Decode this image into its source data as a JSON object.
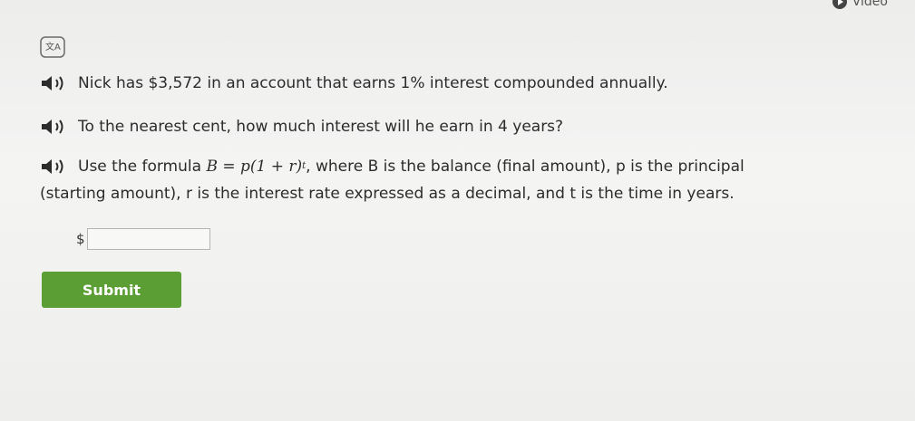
{
  "header": {
    "video_label": "Video"
  },
  "icons": {
    "translate": "translate-icon",
    "speaker": "speaker-icon",
    "video": "play-icon"
  },
  "problem": {
    "line1": "Nick has $3,572 in an account that earns 1% interest compounded annually.",
    "line2": "To the nearest cent, how much interest will he earn in 4 years?",
    "line3_prefix": "Use the formula",
    "formula": "B = p(1 + r)",
    "formula_exponent": "t",
    "line3_suffix": ", where B is the balance (final amount), p is the principal",
    "line4": "(starting amount), r is the interest rate expressed as a decimal, and t is the time in years."
  },
  "answer": {
    "currency_symbol": "$",
    "value": "",
    "placeholder": ""
  },
  "submit_label": "Submit",
  "colors": {
    "accent": "#5b9e34",
    "background": "#efefee",
    "text": "#2c2c2c"
  }
}
